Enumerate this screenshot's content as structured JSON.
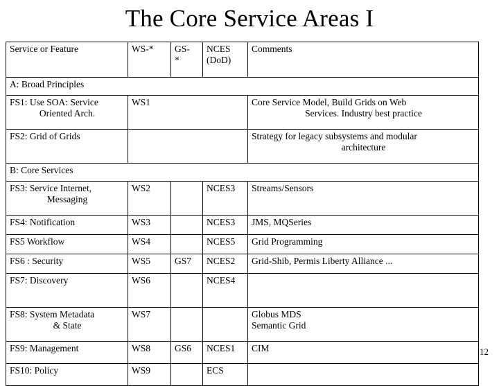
{
  "slide": {
    "title": "The Core Service Areas I",
    "page_number": "12"
  },
  "table": {
    "headers": {
      "service": "Service or Feature",
      "ws": "WS-*",
      "gs_line1": "GS-",
      "gs_line2": "*",
      "nces_line1": "NCES",
      "nces_line2": "(DoD)",
      "comments": "Comments"
    },
    "sections": {
      "a": "A: Broad Principles",
      "b": "B: Core Services"
    },
    "rows": [
      {
        "name_line1": "FS1: Use SOA: Service",
        "name_line2": "Oriented Arch.",
        "ws": "WS1",
        "gs": "",
        "nces": "",
        "comment_line1": "Core Service Model, Build Grids on Web",
        "comment_line2": "Services. Industry best practice"
      },
      {
        "name_line1": "FS2: Grid of Grids",
        "name_line2": "",
        "ws": "",
        "gs": "",
        "nces": "",
        "comment_line1": "Strategy for legacy subsystems and modular",
        "comment_line2": "architecture"
      },
      {
        "name_line1": "FS3: Service Internet,",
        "name_line2": "Messaging",
        "ws": "WS2",
        "gs": "",
        "nces": "NCES3",
        "comment_line1": "Streams/Sensors",
        "comment_line2": ""
      },
      {
        "name_line1": "FS4: Notification",
        "name_line2": "",
        "ws": "WS3",
        "gs": "",
        "nces": "NCES3",
        "comment_line1": "JMS, MQSeries",
        "comment_line2": ""
      },
      {
        "name_line1": "FS5 Workflow",
        "name_line2": "",
        "ws": "WS4",
        "gs": "",
        "nces": "NCES5",
        "comment_line1": "Grid Programming",
        "comment_line2": ""
      },
      {
        "name_line1": "FS6 : Security",
        "name_line2": "",
        "ws": "WS5",
        "gs": "GS7",
        "nces": "NCES2",
        "comment_line1": "Grid-Shib, Permis Liberty Alliance ...",
        "comment_line2": ""
      },
      {
        "name_line1": "FS7: Discovery",
        "name_line2": "",
        "ws": "WS6",
        "gs": "",
        "nces": "NCES4",
        "comment_line1": "",
        "comment_line2": ""
      },
      {
        "name_line1": "FS8: System Metadata",
        "name_line2": "& State",
        "ws": "WS7",
        "gs": "",
        "nces": "",
        "comment_line1": "Globus MDS",
        "comment_line2": "Semantic Grid"
      },
      {
        "name_line1": "FS9: Management",
        "name_line2": "",
        "ws": "WS8",
        "gs": "GS6",
        "nces": "NCES1",
        "comment_line1": "CIM",
        "comment_line2": ""
      },
      {
        "name_line1": "FS10: Policy",
        "name_line2": "",
        "ws": "WS9",
        "gs": "",
        "nces": "ECS",
        "comment_line1": "",
        "comment_line2": ""
      }
    ]
  }
}
